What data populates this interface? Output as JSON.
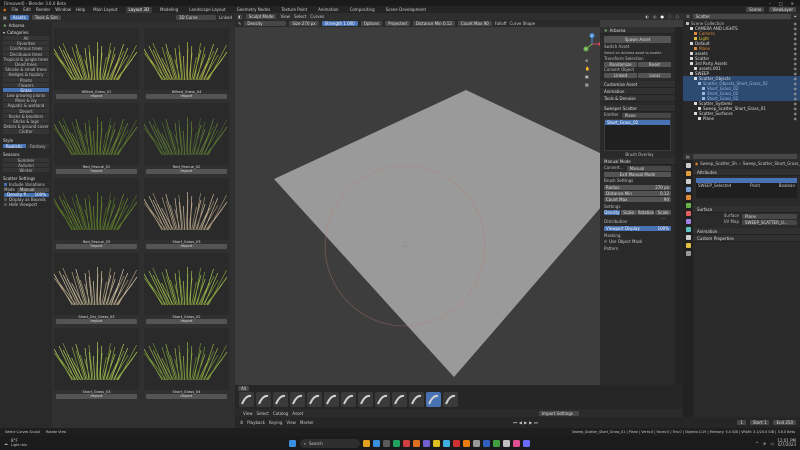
{
  "window": {
    "title": "[Unsaved] - Blender 3.6.0 Beta"
  },
  "menu": {
    "items": [
      "File",
      "Edit",
      "Render",
      "Window",
      "Help"
    ],
    "workspaces": [
      "Main Layout",
      "Layout 3D",
      "Modeling",
      "Landscape Layout",
      "Geometry Nodes",
      "Texture Paint",
      "Animation",
      "Compositing",
      "Scene Development"
    ],
    "active_workspace": "Layout 3D",
    "scene": "Scene",
    "view_layer": "ViewLayer"
  },
  "asset_bar": {
    "tab_assets": "Assets",
    "tab_tools": "Tools & Sim",
    "curve_field": "3D Curve",
    "linked_label": "Linked"
  },
  "left_panel": {
    "addon": "Arborea",
    "categories_label": "Categories",
    "categories": [
      "All",
      "Favorites",
      "Coniferous trees",
      "Deciduous trees",
      "Tropical & jungle trees",
      "Dead trees",
      "Shrubs & small trees",
      "Hedges & topiary",
      "Plants",
      "Flowers",
      "Grass",
      "Low growing plants",
      "Moss & ivy",
      "Aquatic & wetland",
      "Desert",
      "Rocks & boulders",
      "Sticks & logs",
      "Debris & ground cover",
      "Clutter"
    ],
    "selected_category": "Grass",
    "style_label": "Style",
    "style_options": [
      "Realistic",
      "Fantasy"
    ],
    "seasons_label": "Seasons",
    "seasons": [
      "Summer",
      "Autumn",
      "Winter"
    ],
    "scatter_label": "Scatter Settings",
    "include_variations": "Include Variations",
    "mode_label": "Mode",
    "mode_value": "Manual",
    "density_label": "Density P...",
    "density_value": "100%",
    "display_bounds": "Display as Bounds",
    "hide_viewport": "Hide Viewport"
  },
  "assets": [
    {
      "name": "Wilted_Grass_01",
      "button": "Import"
    },
    {
      "name": "Wilted_Grass_04",
      "button": "Import"
    },
    {
      "name": "Red_Fescue_01",
      "button": "Import"
    },
    {
      "name": "Red_Fescue_02",
      "button": "Import"
    },
    {
      "name": "Red_Fescue_03",
      "button": "Import"
    },
    {
      "name": "Short_Grass_03",
      "button": "Import"
    },
    {
      "name": "Short_Dry_Grass_03",
      "button": "Import"
    },
    {
      "name": "Short_Grass_02",
      "button": "Import"
    },
    {
      "name": "Short_Grass_03",
      "button": "Import"
    },
    {
      "name": "Short_Grass_04",
      "button": "Import"
    }
  ],
  "viewport": {
    "mode": "Sculpt Mode",
    "menus": [
      "View",
      "Select",
      "Curves"
    ],
    "brush": "Density",
    "size_label": "Size",
    "size_value": "270 px",
    "strength_label": "Strength",
    "strength_value": "1.000",
    "options": "Options",
    "projected": "Projected",
    "distance_min_label": "Distance Min",
    "distance_min_value": "0.12",
    "count_max_label": "Count Max",
    "count_max_value": "90",
    "falloff": "Falloff",
    "curve_shape": "Curve Shape",
    "triad_x": "X",
    "triad_y": "Y",
    "triad_z": "Z"
  },
  "npanel": {
    "title": "Arborea",
    "spawn_asset": "Spawn Asset",
    "switch_asset_label": "Switch Asset",
    "switch_asset_hint": "Select an Arborea asset to enable",
    "transform_label": "Transform Selection",
    "randomize": "Randomize",
    "reset": "Reset",
    "convert_label": "Convert Object",
    "linked": "Linked",
    "local": "Local",
    "customize": "Customize Asset",
    "animation": "Animation",
    "tools_denoise": "Tools & Denoise",
    "sweeper_title": "Sweeper Scatter",
    "emitter_label": "Emitter",
    "emitter_value": "Plane",
    "list_item": "Short_Grass_02",
    "brush_overlay": "Brush Overlay",
    "manual_mode": "Manual Mode",
    "convert_label2": "Convert...",
    "manual": "Manual",
    "exit_manual": "Exit Manual Mode",
    "brush_settings": "Brush Settings",
    "radius_label": "Radius",
    "radius_value": "270 px",
    "distance_min_label": "Distance Min",
    "distance_min_value": "0.12",
    "count_max_label": "Count Max",
    "count_max_value": "90",
    "settings_label": "Settings",
    "density": "Density",
    "scale": "Scale",
    "rotation": "Rotation",
    "scale2": "Scale ...",
    "distribution": "Distribution",
    "viewport_display": "Viewport Display",
    "viewport_display_value": "100%",
    "masking": "Masking",
    "use_object_mask": "Use Object Mask",
    "pattern": "Pattern"
  },
  "shelf": {
    "all_tab": "All",
    "menus": [
      "View",
      "Select",
      "Catalog",
      "Asset"
    ],
    "import_settings": "Import Settings"
  },
  "outliner": {
    "search_placeholder": "Scatter",
    "items": [
      {
        "label": "Scene Collection",
        "indent": 0,
        "color": "#bdbdbd"
      },
      {
        "label": "CAMERA AND LIGHTS",
        "indent": 1,
        "color": "#ddd"
      },
      {
        "label": "Camera",
        "indent": 2,
        "color": "#e08a3a"
      },
      {
        "label": "Light",
        "indent": 2,
        "color": "#e0c040"
      },
      {
        "label": "Default",
        "indent": 1,
        "color": "#ddd"
      },
      {
        "label": "Plane",
        "indent": 2,
        "color": "#e08a3a"
      },
      {
        "label": "assets",
        "indent": 1,
        "color": "#ddd"
      },
      {
        "label": "Scatter",
        "indent": 1,
        "color": "#ddd"
      },
      {
        "label": "3rd Party Assets",
        "indent": 1,
        "color": "#ddd"
      },
      {
        "label": "assets.001",
        "indent": 2,
        "color": "#ddd"
      },
      {
        "label": "SWEEP",
        "indent": 1,
        "color": "#ddd"
      },
      {
        "label": "Scatter_Objects",
        "indent": 2,
        "color": "#ddd",
        "hl": true
      },
      {
        "label": "Scatter_Objects_Short_Grass_02",
        "indent": 3,
        "color": "#9ab8e0",
        "hl": true
      },
      {
        "label": "Short_Grass_02",
        "indent": 4,
        "color": "#9ab8e0",
        "hl": true
      },
      {
        "label": "Short_Grass_02",
        "indent": 4,
        "color": "#9ab8e0",
        "hl": true
      },
      {
        "label": "Short_Grass_02",
        "indent": 4,
        "color": "#9ab8e0",
        "hl": true
      },
      {
        "label": "Scatter_Systems",
        "indent": 2,
        "color": "#ddd"
      },
      {
        "label": "Sweep_Scatter_Short_Grass_01",
        "indent": 3,
        "color": "#ddd"
      },
      {
        "label": "Scatter_Surfaces",
        "indent": 2,
        "color": "#ddd"
      },
      {
        "label": "Plane",
        "indent": 3,
        "color": "#ddd"
      }
    ]
  },
  "properties": {
    "object": "Sweep_Scatter_Sh...",
    "object_full": "Sweep_Scatter_Short_Grass_01",
    "attributes": "Attributes",
    "attr_selected": "SWEEP_Selected",
    "attr_domain": "Point",
    "attr_type": "Boolean",
    "surface_section": "Surface",
    "surface_label": "Surface",
    "surface_value": "Plane",
    "uv_map_label": "UV Map",
    "uv_map_value": "SWEEP_SCATTER_U...",
    "animation": "Animation",
    "custom_props": "Custom Properties"
  },
  "timeline": {
    "playback": "Playback",
    "keying": "Keying",
    "view": "View",
    "marker": "Marker",
    "frame": "1",
    "start_label": "Start",
    "start": "1",
    "end_label": "End",
    "end": "250"
  },
  "statusbar": {
    "left": "Select Curves Sculpt",
    "left2": "Rotate View",
    "right": "Sweep_Scatter_Short_Grass_01 | Plane | Verts:0 | Faces:0 | Tris:0 | Objects:1/19 | Memory: 5.4 GiB | VRAM: 3.1/24.0 GiB | 3.6.0 Beta"
  },
  "taskbar": {
    "weather_temp": "8°F",
    "weather_desc": "Light rain",
    "search": "Search",
    "time": "12:01 PM",
    "date": "6/7/2023"
  }
}
